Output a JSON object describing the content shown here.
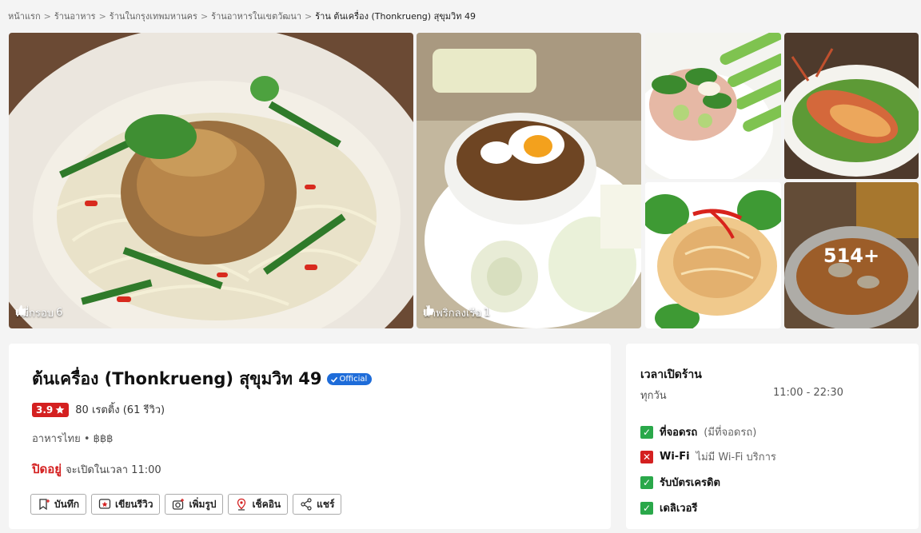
{
  "breadcrumb": {
    "items": [
      "หน้าแรก",
      "ร้านอาหาร",
      "ร้านในกรุงเทพมหานคร",
      "ร้านอาหารในเขตวัฒนา"
    ],
    "current": "ร้าน ต้นเครื่อง (Thonkrueng) สุขุมวิท 49"
  },
  "photos": {
    "main": {
      "caption": "หมี่กรอบ",
      "likes": "6"
    },
    "second": {
      "caption": "น้ำพริกลงเรือ",
      "likes": "1"
    },
    "more_count": "514+"
  },
  "restaurant": {
    "name": "ต้นเครื่อง (Thonkrueng) สุขุมวิท 49",
    "official_label": "Official",
    "rating": "3.9",
    "rating_text": "80 เรตติ้ง (61 รีวิว)",
    "category": "อาหารไทย • ฿฿฿",
    "status": "ปิดอยู่",
    "status_note": "จะเปิดในเวลา 11:00"
  },
  "actions": {
    "save": "บันทึก",
    "review": "เขียนรีวิว",
    "photo": "เพิ่มรูป",
    "checkin": "เช็คอิน",
    "share": "แชร์"
  },
  "hours": {
    "title": "เวลาเปิดร้าน",
    "day": "ทุกวัน",
    "time": "11:00 - 22:30"
  },
  "amenities": [
    {
      "name": "ที่จอดรถ",
      "note": "(มีที่จอดรถ)",
      "available": true
    },
    {
      "name": "Wi-Fi",
      "note": "ไม่มี Wi-Fi บริการ",
      "available": false
    },
    {
      "name": "รับบัตรเครดิต",
      "note": "",
      "available": true
    },
    {
      "name": "เดลิเวอรี",
      "note": "",
      "available": true
    }
  ],
  "colors": {
    "accent_red": "#d42020",
    "official_blue": "#1e6cd9",
    "check_green": "#2aa84a"
  }
}
